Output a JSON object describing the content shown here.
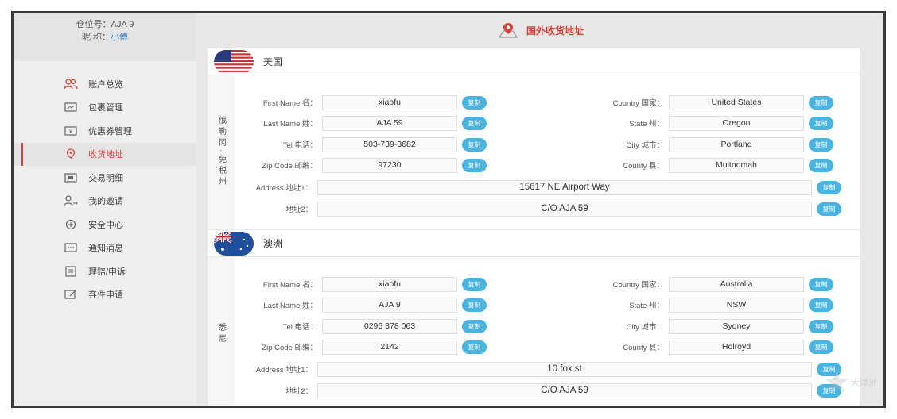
{
  "user": {
    "warehouse_label": "仓位号：AJA   9",
    "nickname_label": "昵 称：",
    "nickname": "小傅"
  },
  "menu": [
    {
      "label": "账户总览",
      "icon": "user-group-icon",
      "active": false
    },
    {
      "label": "包裹管理",
      "icon": "package-icon",
      "active": false
    },
    {
      "label": "优惠券管理",
      "icon": "coupon-icon",
      "active": false
    },
    {
      "label": "收货地址",
      "icon": "location-pin-icon",
      "active": true
    },
    {
      "label": "交易明细",
      "icon": "card-icon",
      "active": false
    },
    {
      "label": "我的邀请",
      "icon": "invite-user-icon",
      "active": false
    },
    {
      "label": "安全中心",
      "icon": "shield-icon",
      "active": false
    },
    {
      "label": "通知消息",
      "icon": "message-icon",
      "active": false
    },
    {
      "label": "理赔/申诉",
      "icon": "claim-icon",
      "active": false
    },
    {
      "label": "弃件申请",
      "icon": "edit-icon",
      "active": false
    }
  ],
  "page_title": "国外收货地址",
  "copy_label": "复制",
  "colors": {
    "accent_red": "#d9403a",
    "copy_blue": "#4bb3e0",
    "nickname_blue": "#3a7fc4"
  },
  "addresses": [
    {
      "country": "美国",
      "warehouse": "俄勒冈·免税州",
      "left": [
        {
          "label": "First Name 名：",
          "value": "xiaofu"
        },
        {
          "label": "Last Name 姓：",
          "value": "AJA   59"
        },
        {
          "label": "Tel 电话：",
          "value": "503-739-3682"
        },
        {
          "label": "Zip Code 邮编：",
          "value": "97230"
        }
      ],
      "right": [
        {
          "label": "Country 国家：",
          "value": "United States"
        },
        {
          "label": "State 州：",
          "value": "Oregon"
        },
        {
          "label": "City 城市：",
          "value": "Portland"
        },
        {
          "label": "County 县：",
          "value": "Multnomah"
        }
      ],
      "address1_label": "Address 地址1：",
      "address1": "15617 NE Airport Way",
      "address2_label": "地址2：",
      "address2": "C/O AJA   59"
    },
    {
      "country": "澳洲",
      "warehouse": "悉尼",
      "left": [
        {
          "label": "First Name 名：",
          "value": "xiaofu"
        },
        {
          "label": "Last Name 姓：",
          "value": "AJA   9"
        },
        {
          "label": "Tel 电话：",
          "value": "0296 378 063"
        },
        {
          "label": "Zip Code 邮编：",
          "value": "2142"
        }
      ],
      "right": [
        {
          "label": "Country 国家：",
          "value": "Australia"
        },
        {
          "label": "State 州：",
          "value": "NSW"
        },
        {
          "label": "City 城市：",
          "value": "Sydney"
        },
        {
          "label": "County 县：",
          "value": "Holroyd"
        }
      ],
      "address1_label": "Address 地址1：",
      "address1": "10 fox st",
      "address2_label": "地址2：",
      "address2": "C/O AJA   59"
    }
  ],
  "watermark": "大洋洲"
}
